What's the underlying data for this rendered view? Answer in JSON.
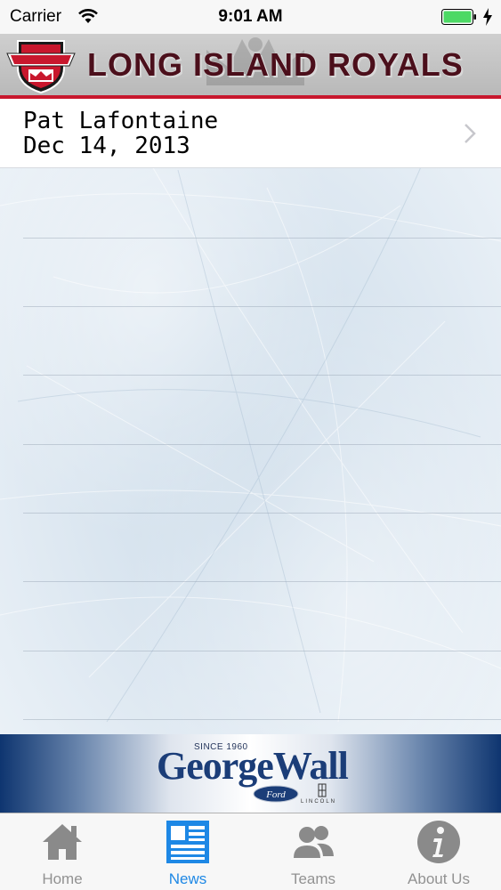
{
  "status_bar": {
    "carrier": "Carrier",
    "time": "9:01 AM",
    "battery_color": "#4cd964"
  },
  "header": {
    "title": "LONG ISLAND ROYALS",
    "logo_icon": "royals-shield-logo",
    "accent_color": "#c8172d"
  },
  "news": {
    "items": [
      {
        "name": "Pat Lafontaine",
        "date": "Dec 14, 2013"
      }
    ]
  },
  "banner": {
    "since": "SINCE 1960",
    "dealer": "GeorgeWall",
    "brand_secondary": "LINCOLN"
  },
  "tabs": [
    {
      "label": "Home",
      "icon": "home-icon",
      "active": false
    },
    {
      "label": "News",
      "icon": "news-icon",
      "active": true
    },
    {
      "label": "Teams",
      "icon": "teams-icon",
      "active": false
    },
    {
      "label": "About Us",
      "icon": "info-icon",
      "active": false
    }
  ]
}
